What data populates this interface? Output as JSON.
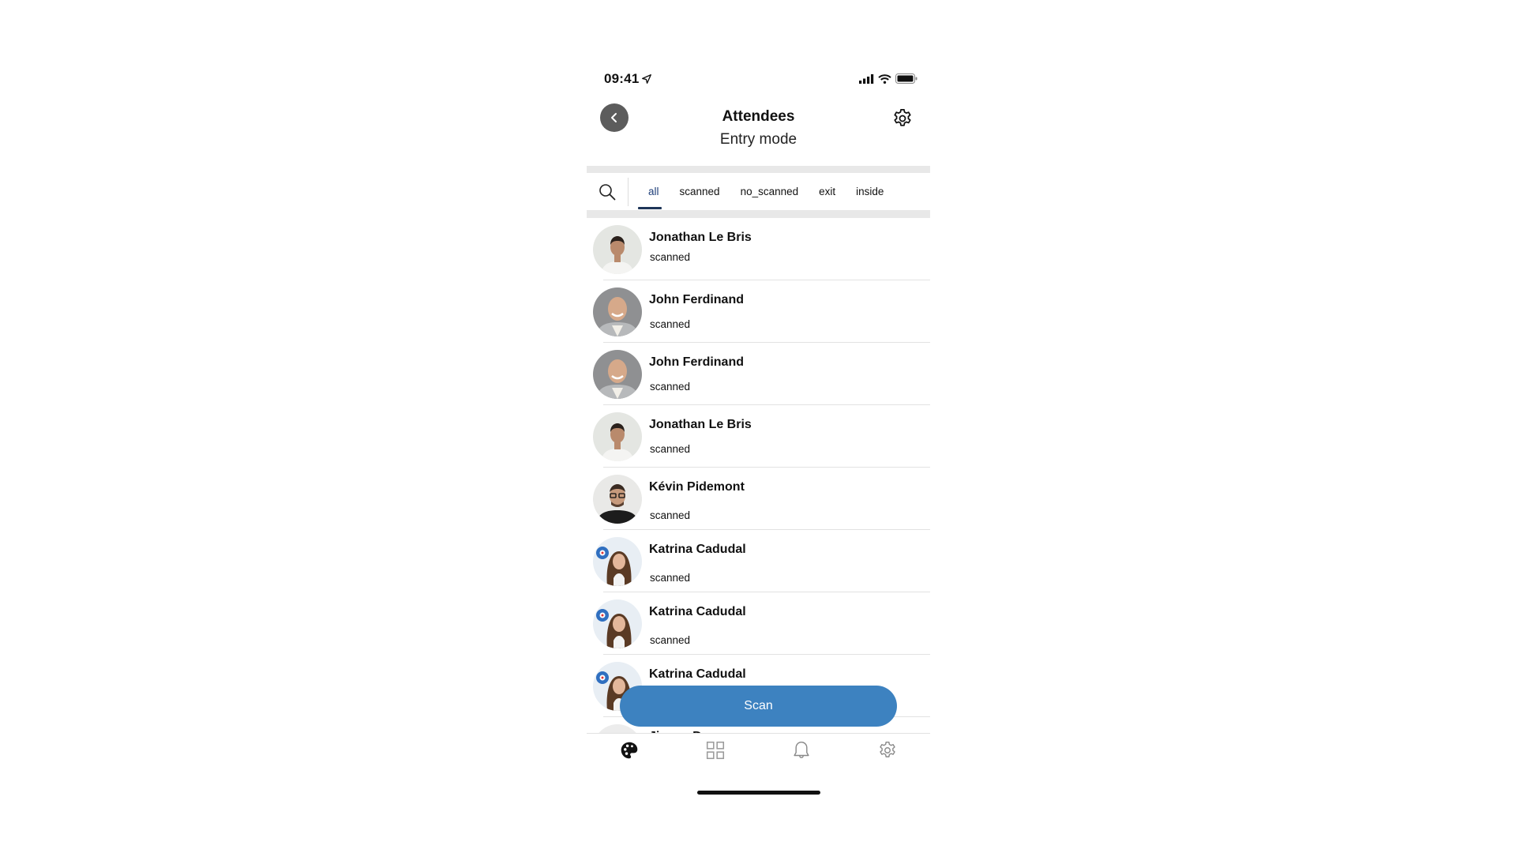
{
  "status_bar": {
    "time": "09:41"
  },
  "header": {
    "title": "Attendees",
    "subtitle": "Entry mode"
  },
  "filters": {
    "active": "all",
    "tabs": [
      {
        "label": "all"
      },
      {
        "label": "scanned"
      },
      {
        "label": "no_scanned"
      },
      {
        "label": "exit"
      },
      {
        "label": "inside"
      }
    ]
  },
  "attendees": [
    {
      "name": "Jonathan Le Bris",
      "status": "scanned",
      "avatar": "man-white-shirt"
    },
    {
      "name": "John Ferdinand",
      "status": "scanned",
      "avatar": "bald-man-smiling"
    },
    {
      "name": "John Ferdinand",
      "status": "scanned",
      "avatar": "bald-man-smiling"
    },
    {
      "name": "Jonathan Le Bris",
      "status": "scanned",
      "avatar": "man-white-shirt"
    },
    {
      "name": "Kévin Pidemont",
      "status": "scanned",
      "avatar": "man-glasses"
    },
    {
      "name": "Katrina Cadudal",
      "status": "scanned",
      "avatar": "woman-long-hair"
    },
    {
      "name": "Katrina Cadudal",
      "status": "scanned",
      "avatar": "woman-long-hair"
    },
    {
      "name": "Katrina Cadudal",
      "status": "",
      "avatar": "woman-long-hair"
    },
    {
      "name": "Jimmy Damay",
      "status": "",
      "avatar": "bald-man"
    }
  ],
  "scan_button": {
    "label": "Scan",
    "color": "#3d82c0"
  },
  "tabbar": {
    "items": [
      {
        "icon": "palette-icon",
        "active": true
      },
      {
        "icon": "grid-icon",
        "active": false
      },
      {
        "icon": "bell-icon",
        "active": false
      },
      {
        "icon": "gear-icon",
        "active": false
      }
    ]
  },
  "colors": {
    "accent": "#1e3558",
    "scan": "#3d82c0",
    "back_button": "#5c5c5c"
  }
}
